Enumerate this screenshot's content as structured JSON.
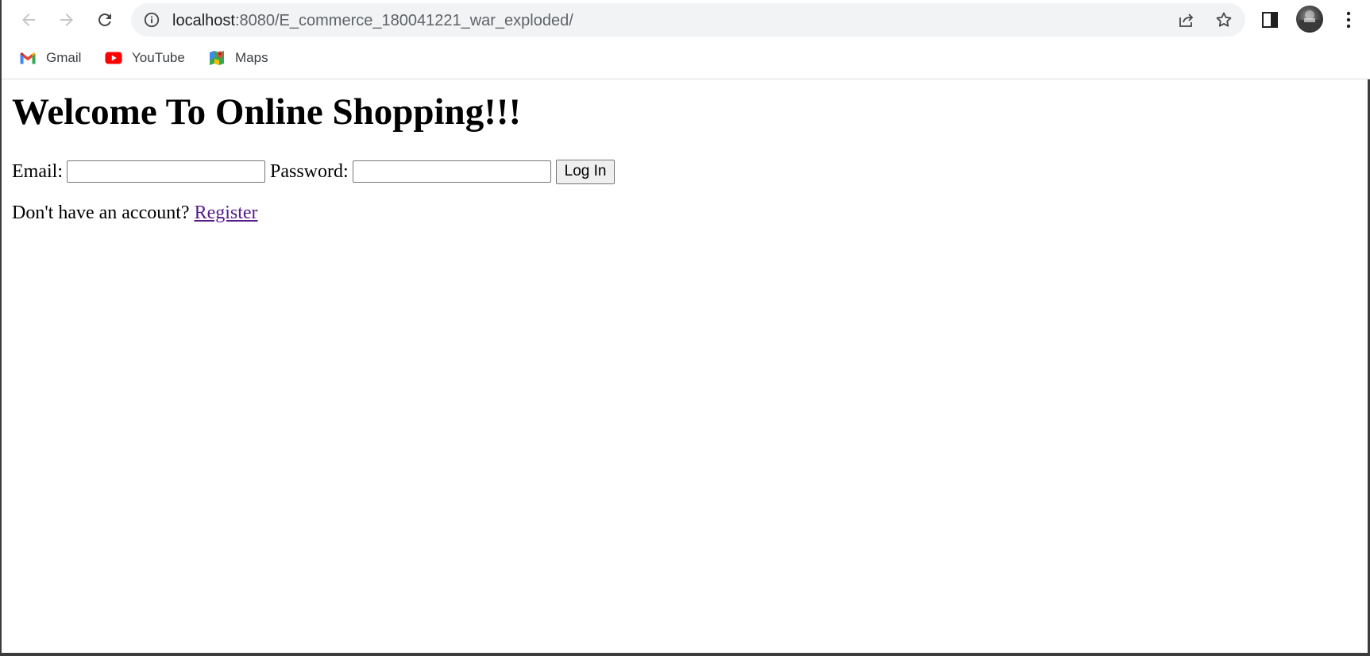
{
  "browser": {
    "address_bar": {
      "host": "localhost",
      "path": ":8080/E_commerce_180041221_war_exploded/"
    },
    "bookmarks": [
      {
        "label": "Gmail",
        "icon": "gmail-icon"
      },
      {
        "label": "YouTube",
        "icon": "youtube-icon"
      },
      {
        "label": "Maps",
        "icon": "maps-icon"
      }
    ]
  },
  "page": {
    "title": "Welcome To Online Shopping!!!",
    "login_form": {
      "email_label": "Email:",
      "email_value": "",
      "password_label": "Password:",
      "password_value": "",
      "submit_label": "Log In"
    },
    "register_prompt": "Don't have an account?",
    "register_link": "Register"
  },
  "colors": {
    "visited_link": "#551a8b",
    "omnibox_bg": "#f1f3f4",
    "youtube_red": "#ff0000"
  }
}
